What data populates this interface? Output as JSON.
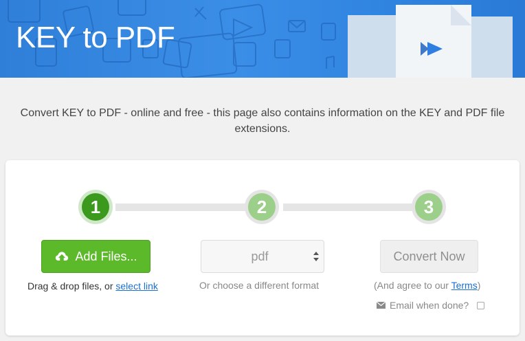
{
  "header": {
    "title": "KEY to PDF"
  },
  "intro": {
    "text": "Convert KEY to PDF - online and free - this page also contains information on the KEY and PDF file extensions."
  },
  "steps": [
    {
      "number": "1",
      "state": "active"
    },
    {
      "number": "2",
      "state": "pending"
    },
    {
      "number": "3",
      "state": "pending"
    }
  ],
  "upload": {
    "button_label": "Add Files...",
    "drag_text": "Drag & drop files, or ",
    "select_link": "select link"
  },
  "format": {
    "selected": "pdf",
    "caption": "Or choose a different format"
  },
  "convert": {
    "button_label": "Convert Now",
    "agree_prefix": "(And agree to our ",
    "terms_link": "Terms",
    "agree_suffix": ")",
    "email_label": "Email when done?",
    "email_checked": false
  },
  "colors": {
    "header_blue": "#3b8ee6",
    "step_active": "#3b9a1e",
    "step_pending": "#9bcf8a",
    "add_button": "#5cba2a",
    "link": "#1a6fd1"
  },
  "icons": [
    "upload-cloud-icon",
    "select-arrows-icon",
    "mail-icon",
    "play-icon"
  ]
}
